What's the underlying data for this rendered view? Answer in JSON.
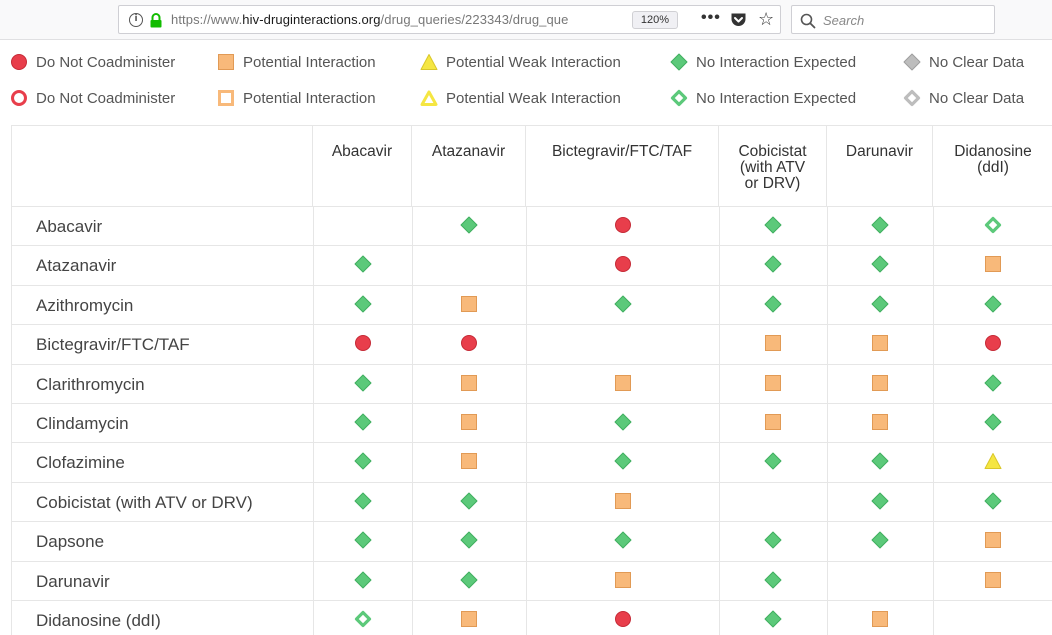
{
  "browser": {
    "url_prefix": "https://www.",
    "url_domain": "hiv-druginteractions.org",
    "url_path": "/drug_queries/223343/drug_que",
    "zoom": "120%",
    "menu_dots": "•••",
    "search_placeholder": "Search"
  },
  "legend": {
    "solid": [
      {
        "symbol": "red-circle",
        "label": "Do Not Coadminister"
      },
      {
        "symbol": "orange-square",
        "label": "Potential Interaction"
      },
      {
        "symbol": "yellow-triangle",
        "label": "Potential Weak Interaction"
      },
      {
        "symbol": "green-diamond",
        "label": "No Interaction Expected"
      },
      {
        "symbol": "grey-diamond",
        "label": "No Clear Data"
      }
    ],
    "outline": [
      {
        "symbol": "red-circle-outline",
        "label": "Do Not Coadminister"
      },
      {
        "symbol": "orange-square-outline",
        "label": "Potential Interaction"
      },
      {
        "symbol": "yellow-triangle-outline",
        "label": "Potential Weak Interaction"
      },
      {
        "symbol": "green-diamond-outline",
        "label": "No Interaction Expected"
      },
      {
        "symbol": "grey-diamond-outline",
        "label": "No Clear Data"
      }
    ]
  },
  "colors": {
    "red": "#e83e4b",
    "orange": "#f8b97a",
    "yellow": "#f5e642",
    "green": "#5cc97a",
    "grey": "#bdbdbd"
  },
  "columns": [
    {
      "name": "Abacavir"
    },
    {
      "name": "Atazanavir"
    },
    {
      "name": "Bictegravir/FTC/TAF"
    },
    {
      "name": "Cobicistat\n(with ATV\nor DRV)"
    },
    {
      "name": "Darunavir"
    },
    {
      "name": "Didanosine\n(ddI)"
    }
  ],
  "rows": [
    {
      "name": "Abacavir",
      "cells": [
        "",
        "green",
        "red",
        "green",
        "green",
        "green-outline"
      ]
    },
    {
      "name": "Atazanavir",
      "cells": [
        "green",
        "",
        "red",
        "green",
        "green",
        "orange"
      ]
    },
    {
      "name": "Azithromycin",
      "cells": [
        "green",
        "orange",
        "green",
        "green",
        "green",
        "green"
      ]
    },
    {
      "name": "Bictegravir/FTC/TAF",
      "cells": [
        "red",
        "red",
        "",
        "orange",
        "orange",
        "red"
      ]
    },
    {
      "name": "Clarithromycin",
      "cells": [
        "green",
        "orange",
        "orange",
        "orange",
        "orange",
        "green"
      ]
    },
    {
      "name": "Clindamycin",
      "cells": [
        "green",
        "orange",
        "green",
        "orange",
        "orange",
        "green"
      ]
    },
    {
      "name": "Clofazimine",
      "cells": [
        "green",
        "orange",
        "green",
        "green",
        "green",
        "yellow"
      ]
    },
    {
      "name": "Cobicistat (with ATV or DRV)",
      "cells": [
        "green",
        "green",
        "orange",
        "",
        "green",
        "green"
      ]
    },
    {
      "name": "Dapsone",
      "cells": [
        "green",
        "green",
        "green",
        "green",
        "green",
        "orange"
      ]
    },
    {
      "name": "Darunavir",
      "cells": [
        "green",
        "green",
        "orange",
        "green",
        "",
        "orange"
      ]
    },
    {
      "name": "Didanosine (ddI)",
      "cells": [
        "green-outline",
        "orange",
        "red",
        "green",
        "orange",
        ""
      ]
    }
  ]
}
